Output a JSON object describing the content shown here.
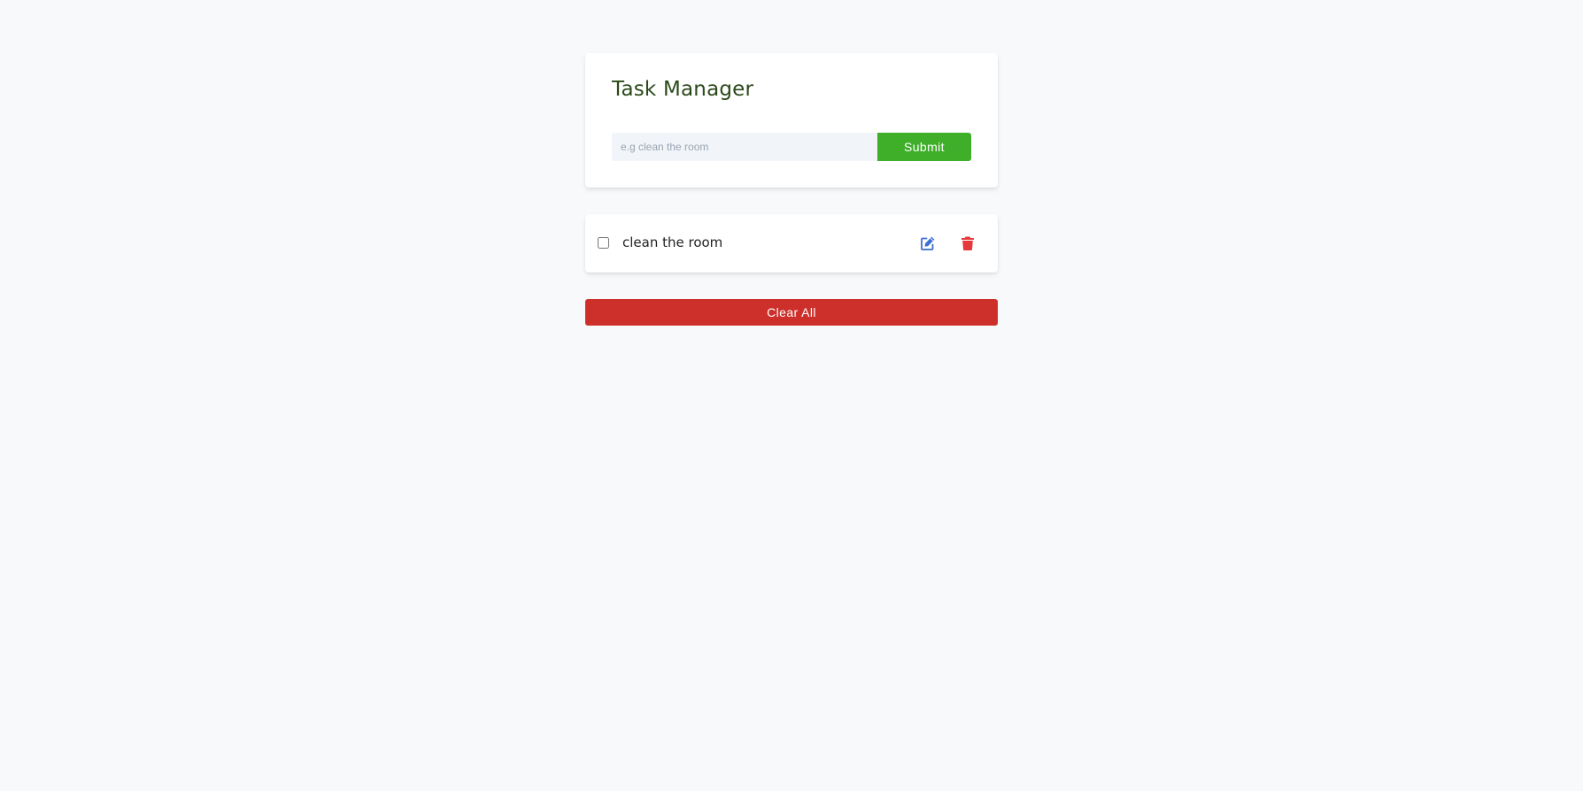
{
  "app": {
    "title": "Task Manager"
  },
  "form": {
    "input_value": "",
    "input_placeholder": "e.g clean the room",
    "submit_label": "Submit"
  },
  "tasks": [
    {
      "text": "clean the room",
      "completed": false,
      "edit_icon": "edit-icon",
      "delete_icon": "trash-icon"
    }
  ],
  "footer": {
    "clear_label": "Clear All"
  },
  "colors": {
    "background": "#f8f9fb",
    "title": "#2b4a1a",
    "submit": "#3faf2a",
    "clear": "#cd302a",
    "edit_icon": "#3b6fd1",
    "delete_icon": "#e5383b",
    "input_bg": "#f1f4f8"
  }
}
